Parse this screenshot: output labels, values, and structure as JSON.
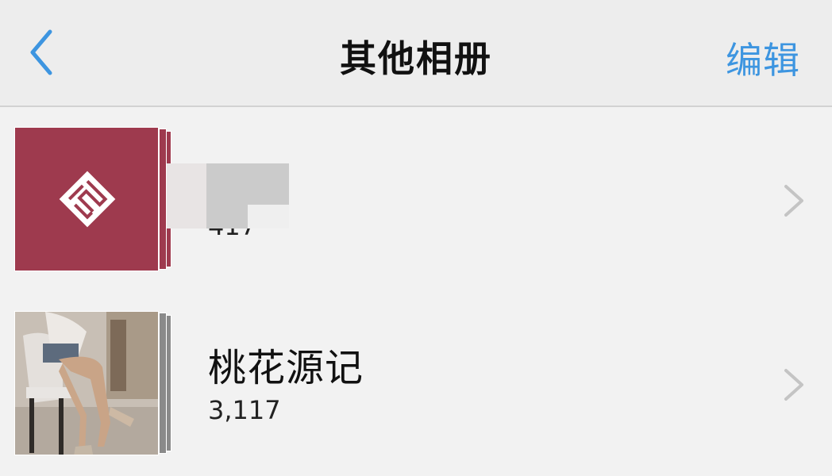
{
  "navbar": {
    "title": "其他相册",
    "edit_label": "编辑",
    "back_icon": "chevron-left-icon"
  },
  "albums": [
    {
      "name": "",
      "count": "417",
      "cover_color": "#9e3a4e",
      "cover_icon": "knot-logo-icon"
    },
    {
      "name": "桃花源记",
      "count": "3,117",
      "cover_icon": "photo-thumbnail"
    }
  ],
  "colors": {
    "accent": "#3d95e0",
    "background": "#f2f2f2",
    "navbar": "#ededed"
  }
}
